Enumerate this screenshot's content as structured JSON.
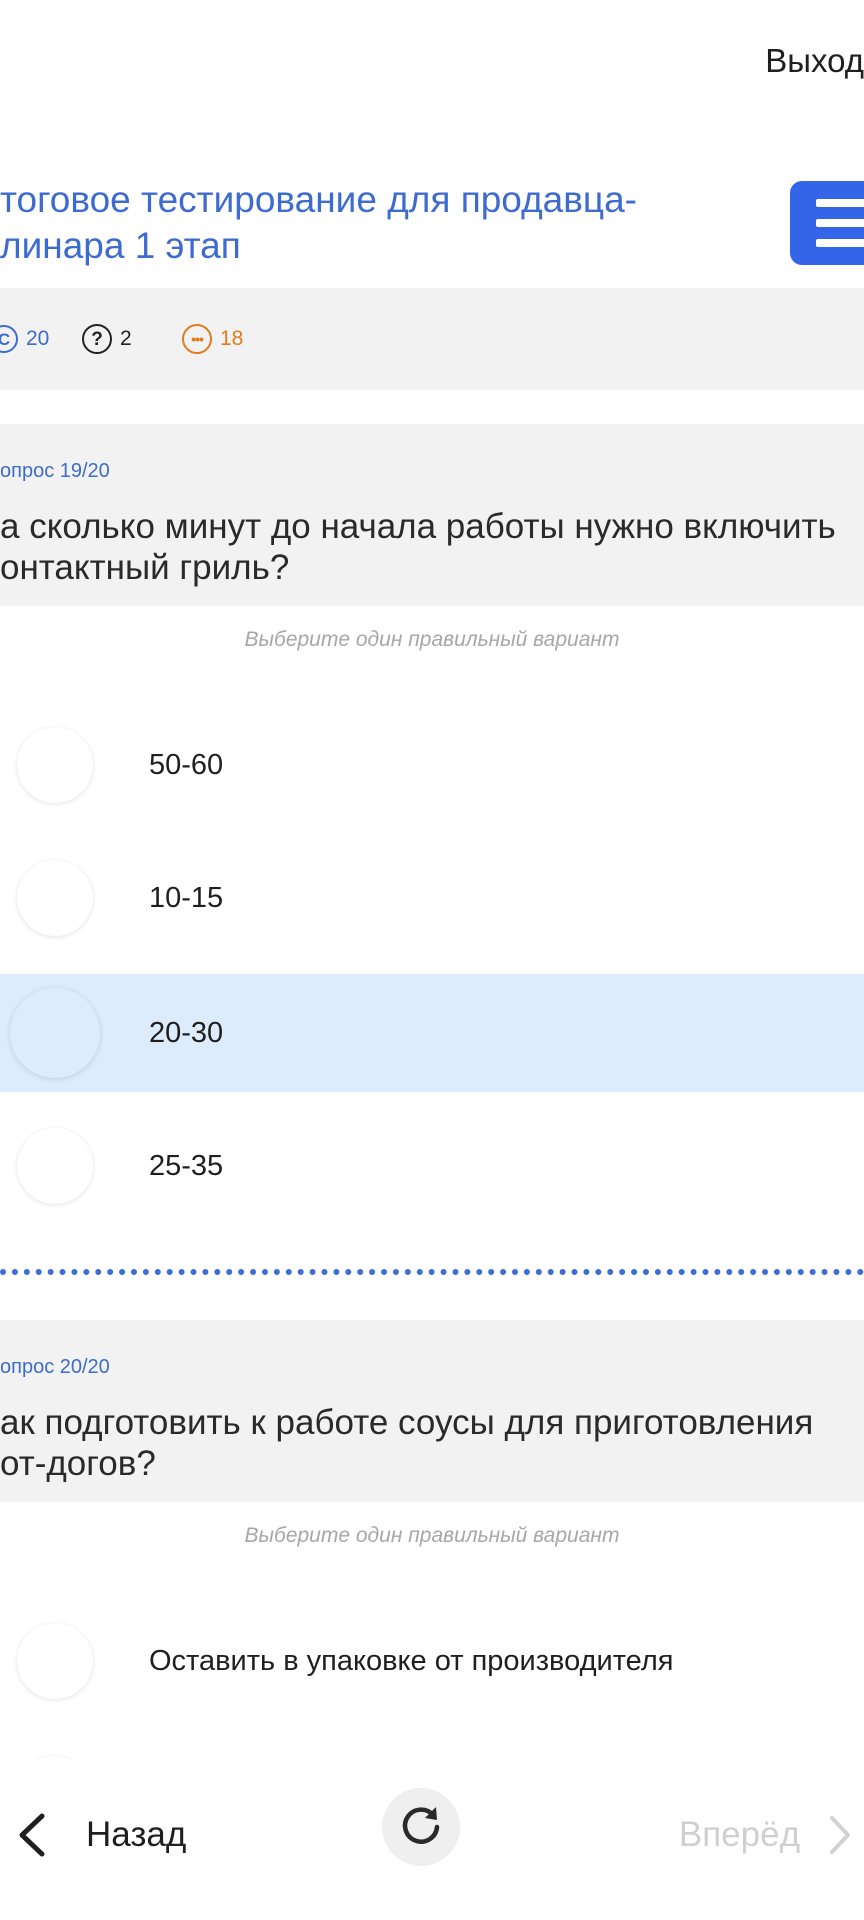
{
  "header": {
    "exit_label": "Выход",
    "title": "тоговое тестирование для продавца-\nлинара 1 этап"
  },
  "stats": {
    "total": "20",
    "unanswered": "2",
    "remaining": "18",
    "colors": {
      "total": "#3d6bd0",
      "unanswered": "#222222",
      "remaining": "#e07b1e"
    }
  },
  "questions": [
    {
      "number_label": "опрос 19/20",
      "text": "а сколько минут до начала работы нужно включить\nонтактный гриль?",
      "hint": "Выберите один правильный вариант",
      "options": [
        {
          "label": "50-60",
          "selected": false
        },
        {
          "label": "10-15",
          "selected": false
        },
        {
          "label": "20-30",
          "selected": true
        },
        {
          "label": "25-35",
          "selected": false
        }
      ]
    },
    {
      "number_label": "опрос 20/20",
      "text": "ак подготовить к работе соусы для приготовления\nот-догов?",
      "hint": "Выберите один правильный вариант",
      "options": [
        {
          "label": "Оставить в упаковке от производителя",
          "selected": false
        }
      ]
    }
  ],
  "nav": {
    "back_label": "Назад",
    "next_label": "Вперёд"
  },
  "colors": {
    "accent": "#3465e8",
    "selected_bg": "#ddecfc",
    "panel_bg": "#f2f2f2"
  }
}
